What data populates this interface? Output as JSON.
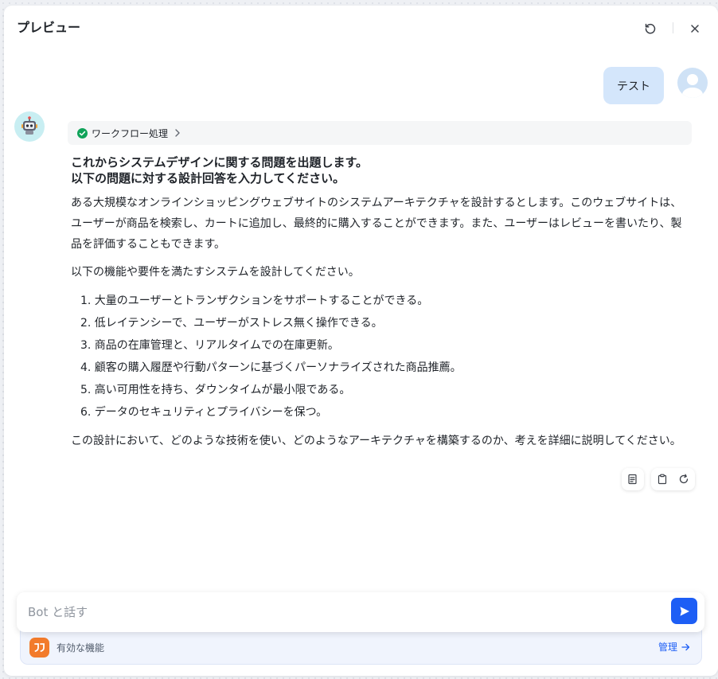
{
  "header": {
    "title": "プレビュー"
  },
  "user_message": {
    "text": "テスト"
  },
  "workflow": {
    "label": "ワークフロー処理"
  },
  "bot_message": {
    "heading_line1": "これからシステムデザインに関する問題を出題します。",
    "heading_line2": "以下の問題に対する設計回答を入力してください。",
    "para1": "ある大規模なオンラインショッピングウェブサイトのシステムアーキテクチャを設計するとします。このウェブサイトは、ユーザーが商品を検索し、カートに追加し、最終的に購入することができます。また、ユーザーはレビューを書いたり、製品を評価することもできます。",
    "para2": "以下の機能や要件を満たすシステムを設計してください。",
    "list": [
      "1. 大量のユーザーとトランザクションをサポートすることができる。",
      "2. 低レイテンシーで、ユーザーがストレス無く操作できる。",
      "3. 商品の在庫管理と、リアルタイムでの在庫更新。",
      "4. 顧客の購入履歴や行動パターンに基づくパーソナライズされた商品推薦。",
      "5. 高い可用性を持ち、ダウンタイムが最小限である。",
      "6. データのセキュリティとプライバシーを保つ。"
    ],
    "para3": "この設計において、どのような技術を使い、どのようなアーキテクチャを構築するのか、考えを詳細に説明してください。"
  },
  "input": {
    "placeholder": "Bot と話す"
  },
  "features": {
    "label": "有効な機能",
    "manage_label": "管理"
  },
  "colors": {
    "accent": "#1d5ef5",
    "user_bubble": "#d4e6fb",
    "feature_icon": "#f27b2b",
    "success": "#10a35a"
  }
}
